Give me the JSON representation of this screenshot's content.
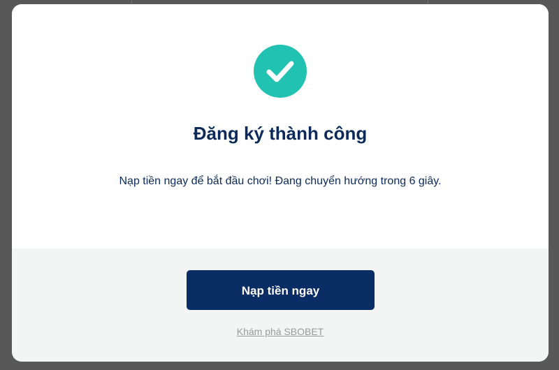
{
  "modal": {
    "title": "Đăng ký thành công",
    "message": "Nạp tiền ngay để bắt đầu chơi! Đang chuyển hướng trong 6 giây.",
    "primary_button_label": "Nạp tiền ngay",
    "secondary_link_label": "Khám phá SBOBET",
    "icon": "check-circle-icon"
  },
  "colors": {
    "accent": "#21c2b2",
    "primary": "#0b2d66",
    "text": "#0b2a5b",
    "link": "#9a9a9a",
    "footer_bg": "#f3f5f5",
    "backdrop": "#585858"
  }
}
